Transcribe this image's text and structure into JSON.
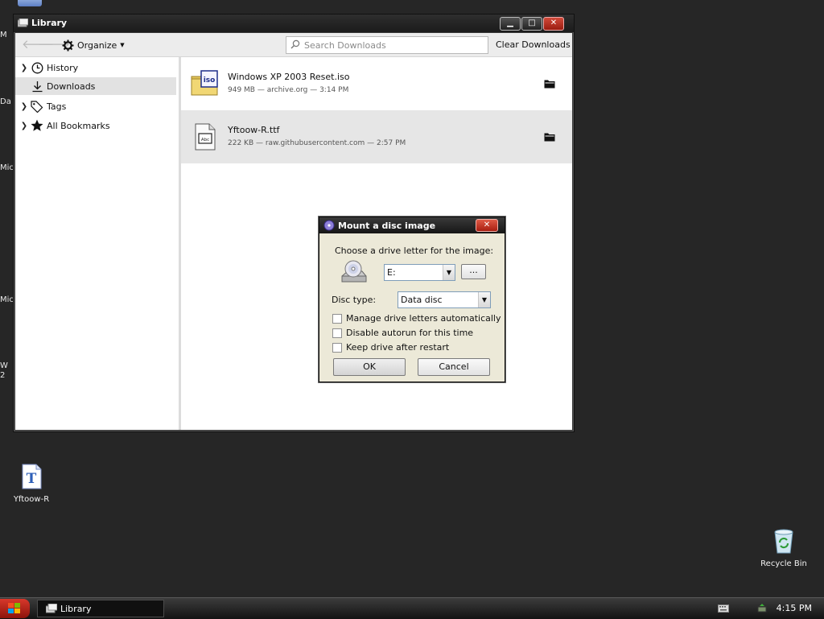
{
  "desktop": {
    "edge_labels": [
      "M",
      "Da",
      "Mic",
      "Mic",
      "W",
      "2"
    ],
    "icons": [
      {
        "label": "Yftoow-R"
      },
      {
        "label": "Recycle Bin"
      }
    ]
  },
  "library": {
    "title": "Library",
    "toolbar": {
      "organize_label": "Organize",
      "search_placeholder": "Search Downloads",
      "clear_label": "Clear Downloads"
    },
    "sidebar": [
      {
        "label": "History"
      },
      {
        "label": "Downloads"
      },
      {
        "label": "Tags"
      },
      {
        "label": "All Bookmarks"
      }
    ],
    "downloads": [
      {
        "name": "Windows XP 2003 Reset.iso",
        "meta": "949 MB — archive.org — 3:14 PM",
        "icon": "iso-file-icon",
        "badge": "iso"
      },
      {
        "name": "Yftoow-R.ttf",
        "meta": "222 KB — raw.githubusercontent.com — 2:57 PM",
        "icon": "font-file-icon",
        "badge": "Abc"
      }
    ]
  },
  "dialog": {
    "title": "Mount a disc image",
    "prompt": "Choose a drive letter for the image:",
    "drive_value": "E:",
    "browse_label": "...",
    "disc_type_label": "Disc type:",
    "disc_type_value": "Data disc",
    "options": [
      {
        "label": "Manage drive letters automatically",
        "checked": false
      },
      {
        "label": "Disable autorun for this time",
        "checked": false
      },
      {
        "label": "Keep drive after restart",
        "checked": false
      }
    ],
    "ok_label": "OK",
    "cancel_label": "Cancel"
  },
  "taskbar": {
    "task_label": "Library",
    "clock": "4:15 PM"
  },
  "colors": {
    "desktop": "#262626",
    "close_red": "#c5311f",
    "dialog_face": "#ece9d8"
  }
}
